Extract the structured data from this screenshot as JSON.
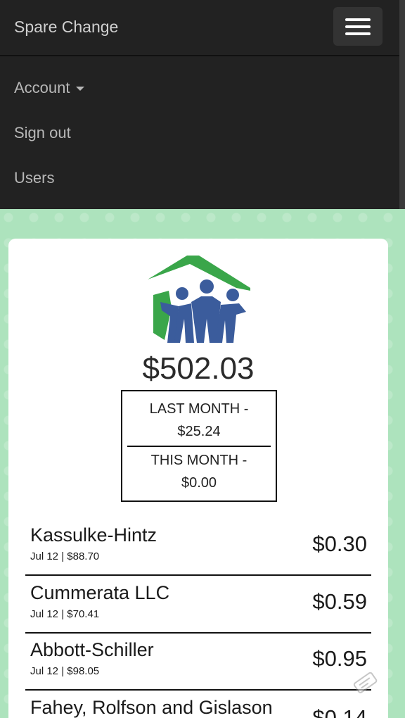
{
  "navbar": {
    "brand": "Spare Change",
    "menu_toggle_icon": "hamburger-menu-icon",
    "items": [
      {
        "label": "Account",
        "has_caret": true
      },
      {
        "label": "Sign out"
      },
      {
        "label": "Users"
      }
    ]
  },
  "summary": {
    "logo_icon": "charity-house-logo-icon",
    "total": "$502.03",
    "last_month_label": "LAST MONTH -",
    "last_month_value": "$25.24",
    "this_month_label": "THIS MONTH -",
    "this_month_value": "$0.00"
  },
  "transactions": [
    {
      "name": "Kassulke-Hintz",
      "meta": "Jul 12 | $88.70",
      "amount": "$0.30"
    },
    {
      "name": "Cummerata LLC",
      "meta": "Jul 12 | $70.41",
      "amount": "$0.59"
    },
    {
      "name": "Abbott-Schiller",
      "meta": "Jul 12 | $98.05",
      "amount": "$0.95"
    },
    {
      "name": "Fahey, Rolfson and Gislason",
      "meta": "",
      "amount": "$0.14"
    }
  ],
  "colors": {
    "navbar_bg": "#222222",
    "page_bg": "#ade3bd",
    "logo_green": "#3aa64a",
    "logo_blue": "#3b5c9c"
  }
}
